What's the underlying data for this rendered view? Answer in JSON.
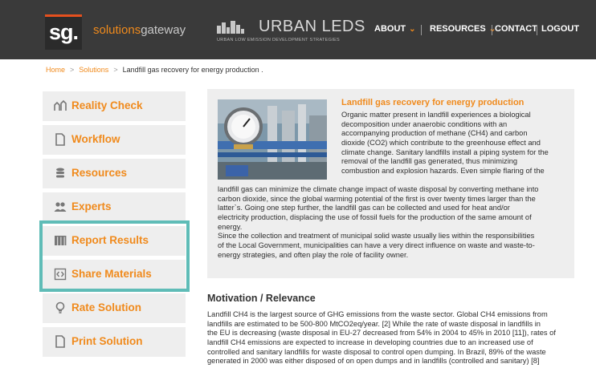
{
  "header": {
    "logo_text": "sg.",
    "brand_highlight": "solutions",
    "brand_rest": "gateway",
    "urban_title": "URBAN LEDS",
    "urban_subtitle": "URBAN LOW EMISSION DEVELOPMENT STRATEGIES",
    "nav": [
      {
        "label": "ABOUT"
      },
      {
        "label": "RESOURCES"
      },
      {
        "label": "CONTACT"
      },
      {
        "label": "LOGOUT"
      }
    ]
  },
  "breadcrumb": {
    "home": "Home",
    "solutions": "Solutions",
    "current": "Landfill gas recovery for energy production ."
  },
  "sidebar": {
    "items": [
      {
        "label": "Reality Check",
        "icon": "chart-icon"
      },
      {
        "label": "Workflow",
        "icon": "document-icon"
      },
      {
        "label": "Resources",
        "icon": "database-icon"
      },
      {
        "label": "Experts",
        "icon": "people-icon"
      },
      {
        "label": "Report Results",
        "icon": "table-icon"
      },
      {
        "label": "Share Materials",
        "icon": "share-icon"
      },
      {
        "label": "Rate Solution",
        "icon": "lightbulb-icon"
      },
      {
        "label": "Print Solution",
        "icon": "document-icon"
      }
    ]
  },
  "content": {
    "title": "Landfill gas recovery for energy production",
    "intro_wrapped": [
      "Organic matter present in landfill experiences a biological",
      "decomposition under anaerobic conditions with an",
      "accompanying production of methane (CH4) and carbon",
      "dioxide (CO2) which contribute to the greenhouse effect and",
      "climate change. Sanitary landfills install a piping system for the",
      "removal of the landfill gas generated, thus minimizing",
      "combustion and explosion hazards. Even simple flaring of the"
    ],
    "intro_full": [
      "landfill gas can minimize the climate change impact of waste disposal by converting methane into",
      "carbon dioxide, since the global warming potential of the first is over twenty times larger than the",
      "latter`s. Going one step further, the landfill gas can be collected and used for heat and/or",
      "electricity production, displacing the use of fossil fuels for the production of the same amount of",
      "energy.",
      "Since the collection and treatment of municipal solid waste usually lies within the responsibilities",
      "of the Local Government, municipalities can have a very direct influence on waste and waste-to-",
      "energy strategies, and often play the role of facility owner."
    ],
    "motivation_title": "Motivation / Relevance",
    "motivation_lines": [
      "Landfill CH4 is the largest source of GHG emissions from the waste sector. Global CH4 emissions from",
      "landfills are estimated to be 500-800 MtCO2eq/year. [2] While the rate of waste disposal in landfills in",
      "the EU is decreasing (waste disposal in EU-27 decreased from 54% in 2004 to 45% in 2010 [11]), rates of",
      "landfill CH4 emissions are expected to increase in developing countries due to an increased use of",
      "controlled and sanitary landfills for waste disposal to control open dumping. In Brazil, 89% of the waste",
      "generated in 2000 was either disposed of on open dumps and in landfills (controlled and sanitary) [8]"
    ]
  },
  "colors": {
    "accent": "#f08a1c",
    "header_bg": "#3a3a3a",
    "highlight": "#5fbcb7",
    "panel_bg": "#eeeeee"
  }
}
